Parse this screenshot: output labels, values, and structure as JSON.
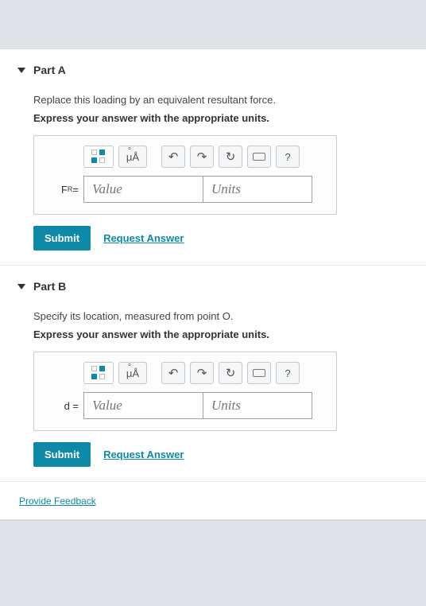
{
  "partA": {
    "title": "Part A",
    "prompt": "Replace this loading by an equivalent resultant force.",
    "instruct": "Express your answer with the appropriate units.",
    "var_html": "F<sub>R</sub> =",
    "value_ph": "Value",
    "units_ph": "Units",
    "submit": "Submit",
    "request": "Request Answer"
  },
  "partB": {
    "title": "Part B",
    "prompt": "Specify its location, measured from point O.",
    "instruct": "Express your answer with the appropriate units.",
    "var_html": "d =",
    "value_ph": "Value",
    "units_ph": "Units",
    "submit": "Submit",
    "request": "Request Answer"
  },
  "toolbar": {
    "micro": "μÅ",
    "help": "?"
  },
  "feedback": "Provide Feedback"
}
